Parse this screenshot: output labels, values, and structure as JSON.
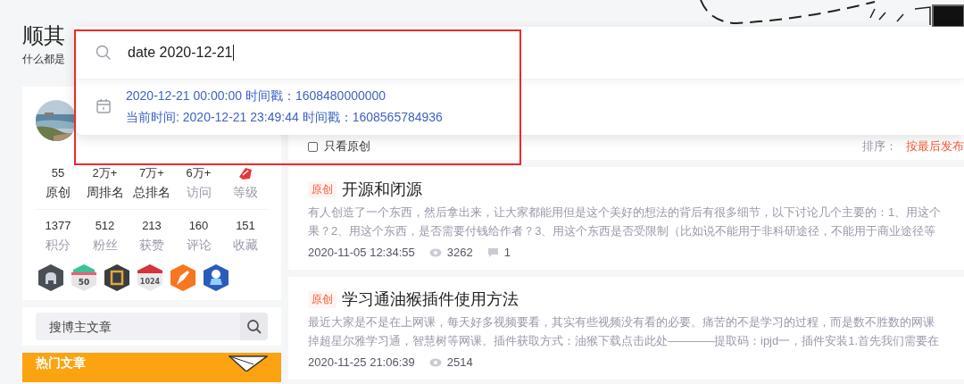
{
  "header": {
    "title": "顺其",
    "subtitle": "什么都是"
  },
  "profile": {
    "stats": [
      {
        "kind": "number",
        "value": "55",
        "label": "原创",
        "muted": false
      },
      {
        "kind": "number",
        "value": "2万+",
        "label": "周排名",
        "muted": false
      },
      {
        "kind": "number",
        "value": "7万+",
        "label": "总排名",
        "muted": false
      },
      {
        "kind": "number",
        "value": "6万+",
        "label": "访问",
        "muted": true
      },
      {
        "kind": "level",
        "label": "等级",
        "muted": true
      }
    ],
    "stats2": [
      {
        "kind": "number",
        "value": "1377",
        "label": "积分",
        "muted": true
      },
      {
        "kind": "number",
        "value": "512",
        "label": "粉丝",
        "muted": true
      },
      {
        "kind": "number",
        "value": "213",
        "label": "获赞",
        "muted": true
      },
      {
        "kind": "number",
        "value": "160",
        "label": "评论",
        "muted": true
      },
      {
        "kind": "number",
        "value": "151",
        "label": "收藏",
        "muted": true
      }
    ],
    "badges": [
      {
        "kind": "github"
      },
      {
        "kind": "years",
        "text": "50"
      },
      {
        "kind": "persist"
      },
      {
        "kind": "code",
        "text": "1024"
      },
      {
        "kind": "pen"
      },
      {
        "kind": "astronaut"
      }
    ]
  },
  "blog_search": {
    "placeholder": "搜博主文章"
  },
  "hot_articles": {
    "title": "热门文章"
  },
  "filter": {
    "checkbox": {
      "label": "只看原创",
      "checked": false
    },
    "sort_label": "排序：",
    "sort_value": "按最后发布"
  },
  "articles": [
    {
      "tag": "原创",
      "title": "开源和闭源",
      "summary_lines": [
        "有人创造了一个东西，然后拿出来，让大家都能用但是这个美好的想法的背后有很多细节，以下讨论几个主要的：1、用这个",
        "果？2、用这个东西，是否需要付钱给作者？3、用这个东西是否受限制（比如说不能用于非科研途径，不能用于商业途径等"
      ],
      "date": "2020-11-05 12:34:55",
      "views": "3262",
      "comments": "1"
    },
    {
      "tag": "原创",
      "title": "学习通油猴插件使用方法",
      "summary_lines": [
        "最近大家是不是在上网课，每天好多视频要看，其实有些视频没有看的必要。痛苦的不是学习的过程，而是数不胜数的网课",
        "掉超星尔雅学习通，智慧树等网课。插件获取方式：油猴下载点击此处————提取码：ipjd一，插件安装1.首先我们需要在"
      ],
      "date": "2020-11-25 21:06:39",
      "views": "2514"
    }
  ],
  "popup": {
    "query": "date 2020-12-21",
    "results": [
      {
        "lines": [
          "2020-12-21 00:00:00 时间戳：1608480000000",
          "当前时间: 2020-12-21 23:49:44 时间戳：1608565784936"
        ]
      }
    ]
  }
}
